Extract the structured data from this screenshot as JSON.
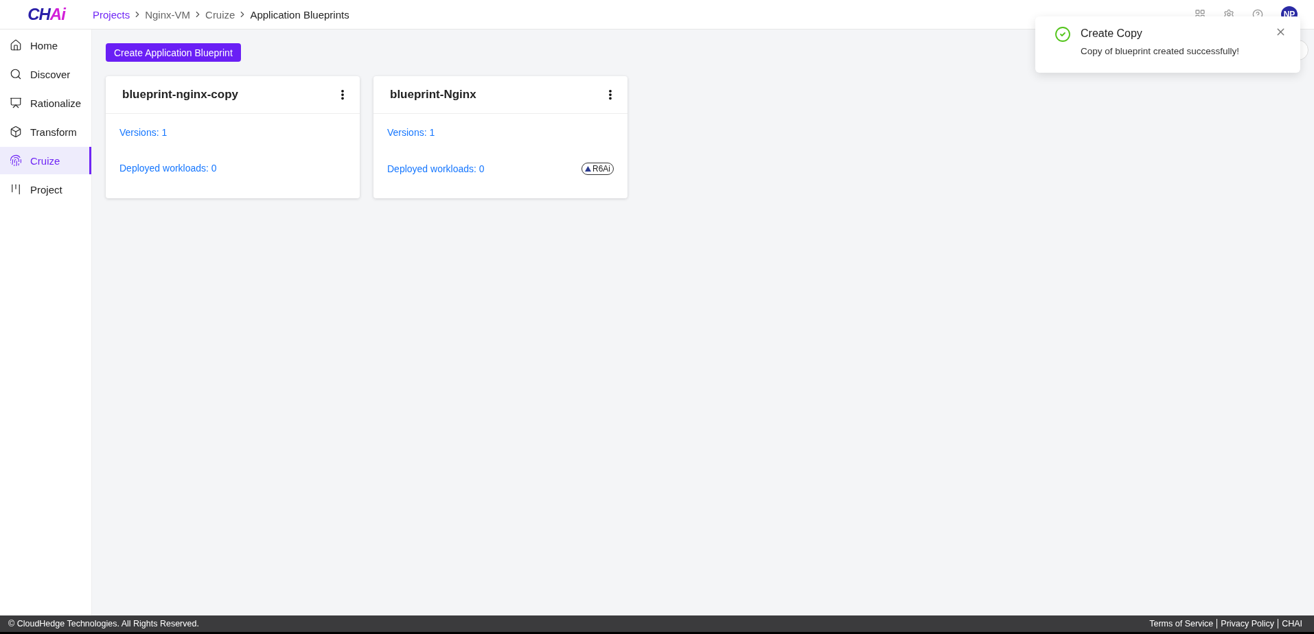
{
  "logo": {
    "text": "CH",
    "accent": "Ai"
  },
  "breadcrumbs": [
    {
      "label": "Projects",
      "kind": "link"
    },
    {
      "label": "Nginx-VM",
      "kind": "link"
    },
    {
      "label": "Cruize",
      "kind": "link"
    },
    {
      "label": "Application Blueprints",
      "kind": "current"
    }
  ],
  "user": {
    "initials": "NP"
  },
  "sidebar": {
    "items": [
      {
        "label": "Home",
        "selected": false
      },
      {
        "label": "Discover",
        "selected": false
      },
      {
        "label": "Rationalize",
        "selected": false
      },
      {
        "label": "Transform",
        "selected": false
      },
      {
        "label": "Cruize",
        "selected": true
      },
      {
        "label": "Project",
        "selected": false
      }
    ]
  },
  "create_button": "Create Application Blueprint",
  "cards": [
    {
      "title": "blueprint-nginx-copy",
      "versions": "Versions: 1",
      "workloads": "Deployed workloads: 0"
    },
    {
      "title": "blueprint-Nginx",
      "versions": "Versions: 1",
      "workloads": "Deployed workloads: 0",
      "badge": "R6Ai"
    }
  ],
  "toast": {
    "title": "Create Copy",
    "message": "Copy of blueprint created successfully!"
  },
  "footer": {
    "copyright": "© CloudHedge Technologies. All Rights Reserved.",
    "links": [
      "Terms of Service",
      "Privacy Policy",
      "CHAI"
    ]
  }
}
